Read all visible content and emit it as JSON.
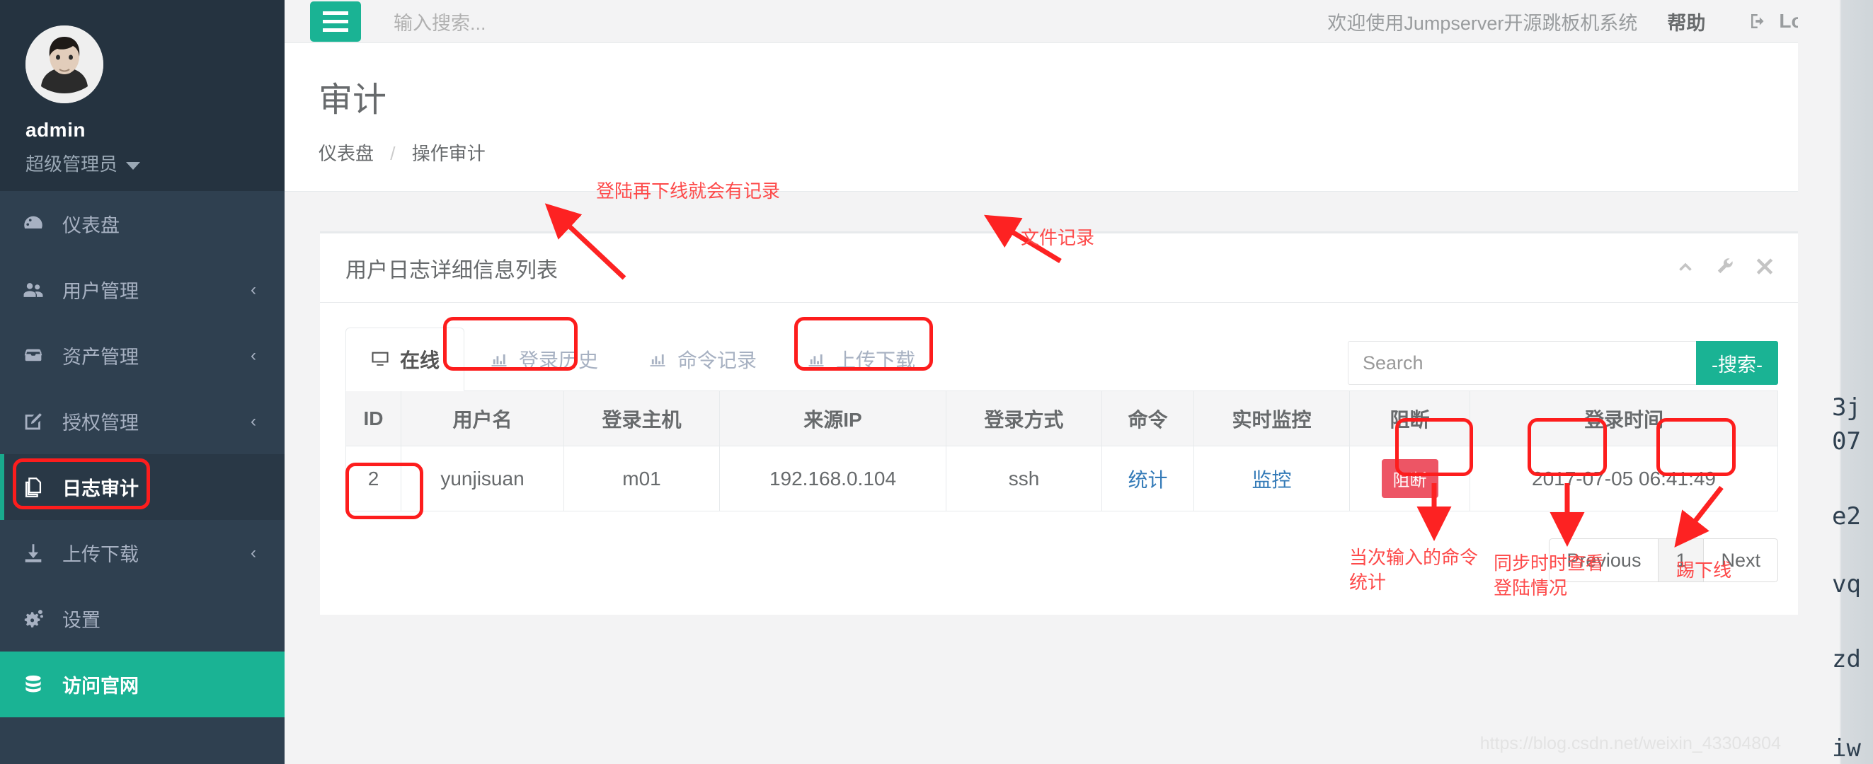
{
  "sidebar": {
    "user": {
      "name": "admin",
      "role": "超级管理员",
      "avatar_icon": "user-avatar"
    },
    "items": [
      {
        "label": "仪表盘",
        "icon": "dashboard-icon",
        "chevron": "",
        "active": false
      },
      {
        "label": "用户管理",
        "icon": "users-icon",
        "chevron": "‹",
        "active": false
      },
      {
        "label": "资产管理",
        "icon": "inbox-icon",
        "chevron": "‹",
        "active": false
      },
      {
        "label": "授权管理",
        "icon": "edit-icon",
        "chevron": "‹",
        "active": false
      },
      {
        "label": "日志审计",
        "icon": "copy-icon",
        "chevron": "",
        "active": true
      },
      {
        "label": "上传下载",
        "icon": "download-icon",
        "chevron": "‹",
        "active": false
      },
      {
        "label": "设置",
        "icon": "gears-icon",
        "chevron": "",
        "active": false
      },
      {
        "label": "访问官网",
        "icon": "database-icon",
        "chevron": "",
        "active": false
      }
    ]
  },
  "topnav": {
    "menu_icon": "hamburger-icon",
    "search_placeholder": "输入搜索...",
    "welcome": "欢迎使用Jumpserver开源跳板机系统",
    "help": "帮助",
    "logout": "Log out",
    "logout_icon": "sign-out-icon"
  },
  "page": {
    "title": "审计",
    "breadcrumb": {
      "root": "仪表盘",
      "sep": "/",
      "current": "操作审计"
    },
    "settings_icon": "gears-icon"
  },
  "panel": {
    "title": "用户日志详细信息列表",
    "tools": [
      "chevron-up-icon",
      "wrench-icon",
      "close-icon"
    ],
    "tabs": [
      {
        "label": "在线",
        "icon": "monitor-icon",
        "active": true
      },
      {
        "label": "登录历史",
        "icon": "bar-chart-icon",
        "active": false
      },
      {
        "label": "命令记录",
        "icon": "bar-chart-icon",
        "active": false
      },
      {
        "label": "上传下载",
        "icon": "bar-chart-icon",
        "active": false
      }
    ],
    "search": {
      "value": "",
      "placeholder": "Search",
      "button_label": "-搜索-"
    },
    "table": {
      "headers": [
        "ID",
        "用户名",
        "登录主机",
        "来源IP",
        "登录方式",
        "命令",
        "实时监控",
        "阻断",
        "登录时间"
      ],
      "rows": [
        {
          "id": "2",
          "username": "yunjisuan",
          "host": "m01",
          "source_ip": "192.168.0.104",
          "login_type": "ssh",
          "command": "统计",
          "monitor": "监控",
          "block": "阻断",
          "login_time": "2017-07-05 06:41:49"
        }
      ]
    },
    "pagination": {
      "previous": "Previous",
      "pages": [
        "1"
      ],
      "next": "Next"
    }
  },
  "annotations": [
    {
      "id": "a1",
      "text": "登陆再下线就会有记录"
    },
    {
      "id": "a2",
      "text": "文件记录"
    },
    {
      "id": "a3",
      "text": "当次输入的命令\n统计"
    },
    {
      "id": "a4",
      "text": "同步时时查看\n登陆情况"
    },
    {
      "id": "a5",
      "text": "踢下线"
    }
  ],
  "right_edge": {
    "fragments": [
      "3j",
      "07",
      "e2",
      "vq",
      "zd",
      "iw"
    ]
  },
  "watermark": "https://blog.csdn.net/weixin_43304804",
  "colors": {
    "brand_green": "#1ab394",
    "sidebar_bg": "#2f4050",
    "sidebar_profile_bg": "#253340",
    "annotation_red": "#fd4a4a",
    "danger": "#ed5565",
    "link_blue": "#337ab7"
  }
}
